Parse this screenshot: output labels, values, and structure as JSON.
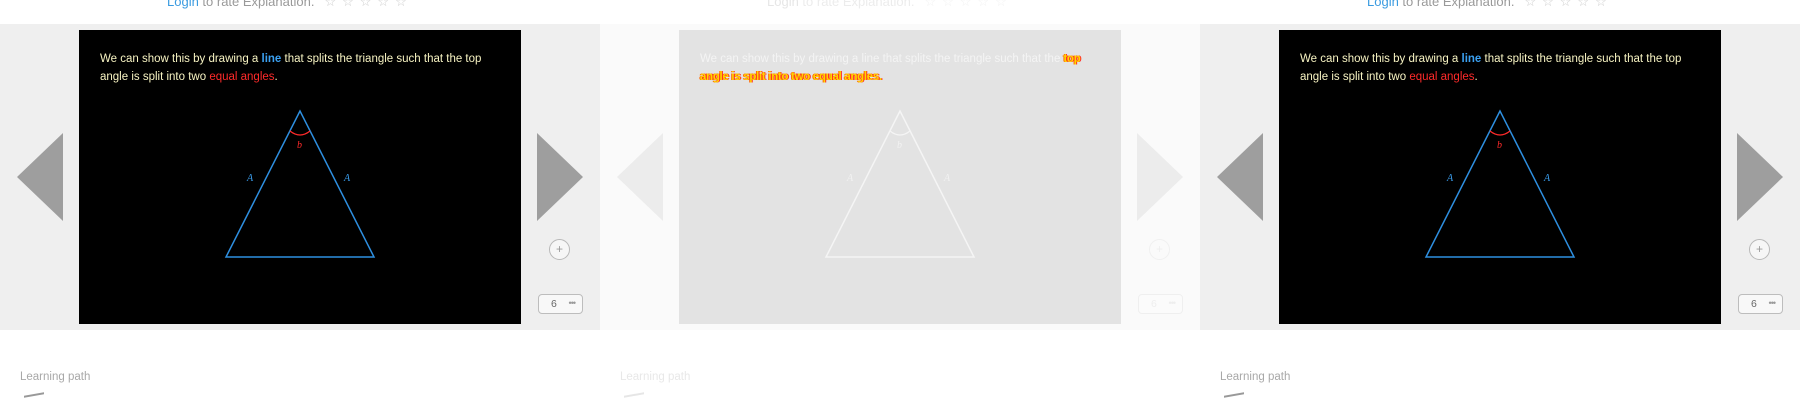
{
  "panels": [
    {
      "rate": {
        "login_label": "Login",
        "text": " to rate Explanation.",
        "stars": "☆☆☆☆☆"
      },
      "slide": {
        "caption_a": "We can show this by drawing a ",
        "caption_line": "line",
        "caption_b": " that splits the triangle such that the top angle is split into two ",
        "caption_equal": "equal angles",
        "caption_end": ".",
        "label_left_side": "A",
        "label_right_side": "A",
        "label_angle": "b"
      },
      "zoom_glyph": "+",
      "counter": {
        "value": "6",
        "dots": "•••"
      },
      "learning_path_label": "Learning path"
    },
    {
      "rate": {
        "login_label": "Login",
        "text": " to rate Explanation.",
        "stars": "☆☆☆☆☆"
      },
      "slide": {
        "caption_a": "We can show this by drawing a ",
        "caption_line": "line",
        "caption_b": " that splits the triangle such that the ",
        "caption_scramble": "top angle is split into two equal angles.",
        "label_left_side": "A",
        "label_right_side": "A",
        "label_angle": "b"
      },
      "zoom_glyph": "+",
      "counter": {
        "value": "6",
        "dots": "•••"
      },
      "learning_path_label": "Learning path"
    },
    {
      "rate": {
        "login_label": "Login",
        "text": " to rate Explanation.",
        "stars": "☆☆☆☆☆"
      },
      "slide": {
        "caption_a": "We can show this by drawing a ",
        "caption_line": "line",
        "caption_b": " that splits the triangle such that the top angle is split into two ",
        "caption_equal": "equal angles",
        "caption_end": ".",
        "label_left_side": "A",
        "label_right_side": "A",
        "label_angle": "b"
      },
      "zoom_glyph": "+",
      "counter": {
        "value": "6",
        "dots": "•••"
      },
      "learning_path_label": "Learning path"
    }
  ],
  "colors": {
    "triangle_stroke": "#2e8fe0",
    "angle_arc": "#ff2a2a",
    "nav_arrow": "#9e9e9e",
    "nav_arrow_ghost": "#ececec",
    "login_link": "#3a9be0"
  },
  "icons": {
    "prev": "triangle-left-arrow-icon",
    "next": "triangle-right-arrow-icon",
    "zoom": "zoom-plus-icon",
    "learning_path": "learning-path-icon"
  }
}
